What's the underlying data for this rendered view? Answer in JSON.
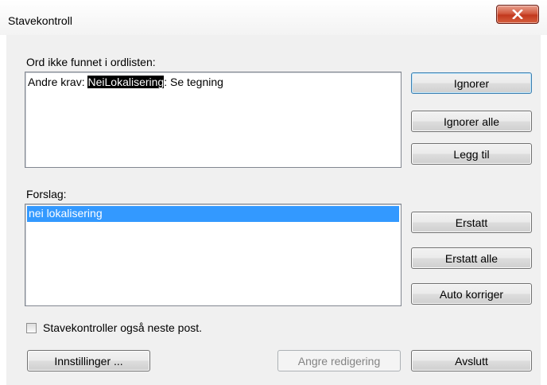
{
  "window": {
    "title": "Stavekontroll",
    "close_icon": "close-icon"
  },
  "not_found": {
    "label": "Ord ikke funnet i ordlisten:",
    "text_before": "Andre krav: ",
    "highlighted_word": "NeiLokalisering",
    "text_after": ": Se tegning"
  },
  "buttons": {
    "ignore": "Ignorer",
    "ignore_all": "Ignorer alle",
    "add": "Legg til",
    "replace": "Erstatt",
    "replace_all": "Erstatt alle",
    "auto_correct": "Auto korriger",
    "settings": "Innstillinger ...",
    "undo_edit": "Angre redigering",
    "exit": "Avslutt"
  },
  "suggestions": {
    "label": "Forslag:",
    "items": [
      "nei lokalisering"
    ]
  },
  "checkbox": {
    "label": "Stavekontroller også neste post.",
    "checked": false
  },
  "colors": {
    "selection": "#3399ff",
    "close_button": "#c2391e",
    "dialog_background": "#f0f0f0"
  }
}
